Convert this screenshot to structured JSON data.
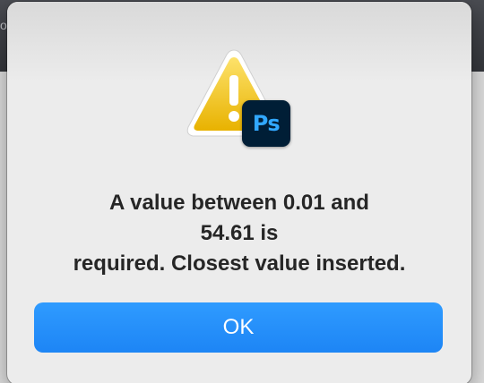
{
  "background": {
    "partial_glyph": "o"
  },
  "dialog": {
    "message_lines": [
      "A value between 0.01 and",
      "54.61 is",
      "required. Closest value inserted."
    ],
    "ok_label": "OK",
    "app_badge": "Ps"
  },
  "colors": {
    "button_accent": "#1d85f5",
    "ps_badge_bg": "#001e36",
    "ps_badge_text": "#31a8ff",
    "warning_yellow": "#f4c400"
  }
}
